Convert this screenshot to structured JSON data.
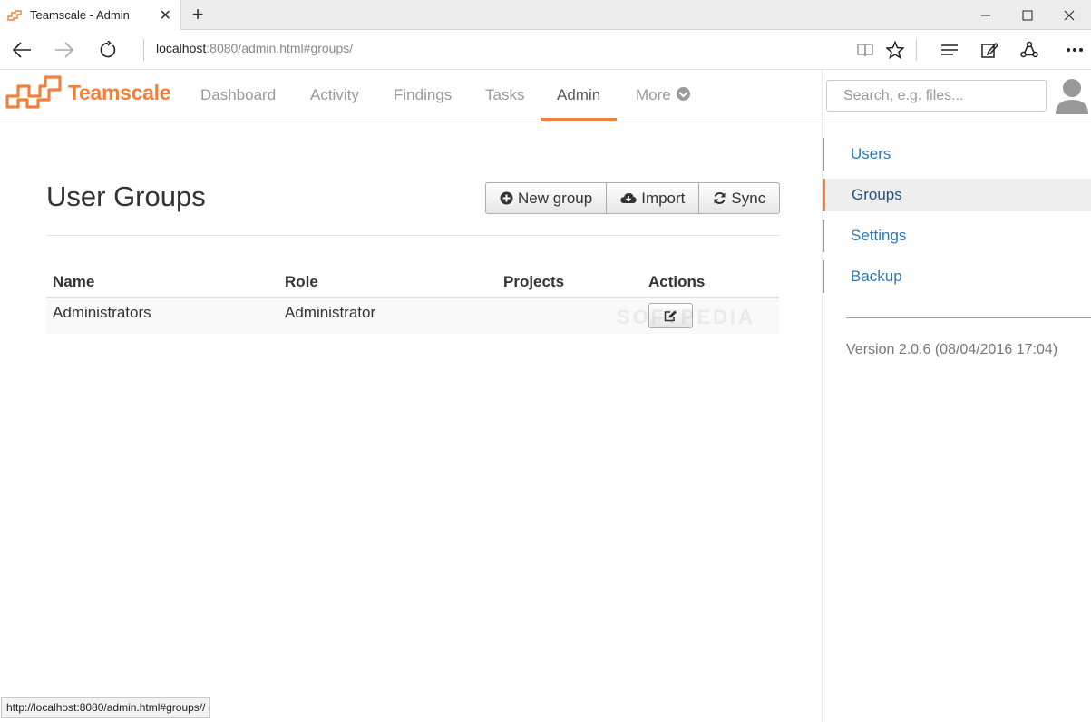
{
  "browser": {
    "tab_title": "Teamscale - Admin",
    "url_host": "localhost",
    "url_rest": ":8080/admin.html#groups/",
    "status_url": "http://localhost:8080/admin.html#groups//"
  },
  "header": {
    "brand": "Teamscale",
    "nav": [
      "Dashboard",
      "Activity",
      "Findings",
      "Tasks",
      "Admin",
      "More"
    ],
    "active_nav": "Admin",
    "search_placeholder": "Search, e.g. files...",
    "accent_color": "#f0803c"
  },
  "main": {
    "title": "User Groups",
    "buttons": {
      "new_group": "New group",
      "import": "Import",
      "sync": "Sync"
    },
    "table": {
      "columns": [
        "Name",
        "Role",
        "Projects",
        "Actions"
      ],
      "rows": [
        {
          "name": "Administrators",
          "role": "Administrator",
          "projects": ""
        }
      ]
    }
  },
  "sidebar": {
    "items": [
      "Users",
      "Groups",
      "Settings",
      "Backup"
    ],
    "active": "Groups",
    "version": "Version 2.0.6 (08/04/2016 17:04)"
  }
}
